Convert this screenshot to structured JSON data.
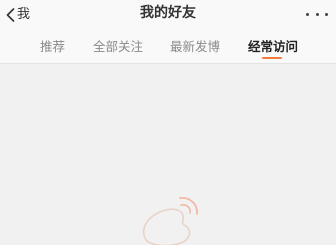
{
  "header": {
    "back_label": "我",
    "title": "我的好友",
    "back_icon": "chevron-left-icon",
    "more_icon": "more-horizontal-icon"
  },
  "tabs": [
    {
      "label": "推荐",
      "active": false
    },
    {
      "label": "全部关注",
      "active": false
    },
    {
      "label": "最新发博",
      "active": false
    },
    {
      "label": "经常访问",
      "active": true
    }
  ],
  "loading": {
    "icon": "weibo-loading-icon"
  },
  "colors": {
    "accent": "#f27a3a",
    "background": "#f1f1f1",
    "header_background": "#f9f9f9",
    "tab_inactive": "#8a8a8a",
    "text": "#333333"
  }
}
